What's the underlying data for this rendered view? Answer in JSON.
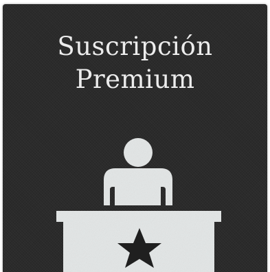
{
  "title": {
    "line1": "Suscripción",
    "line2": "Premium"
  },
  "icon": {
    "name": "desk-attendant-icon",
    "desk_badge": "star-icon"
  },
  "colors": {
    "background": "#2b2b2b",
    "title_text": "#ececec",
    "icon_fill": "#e3e6e6",
    "star_fill": "#1f1f1f"
  }
}
